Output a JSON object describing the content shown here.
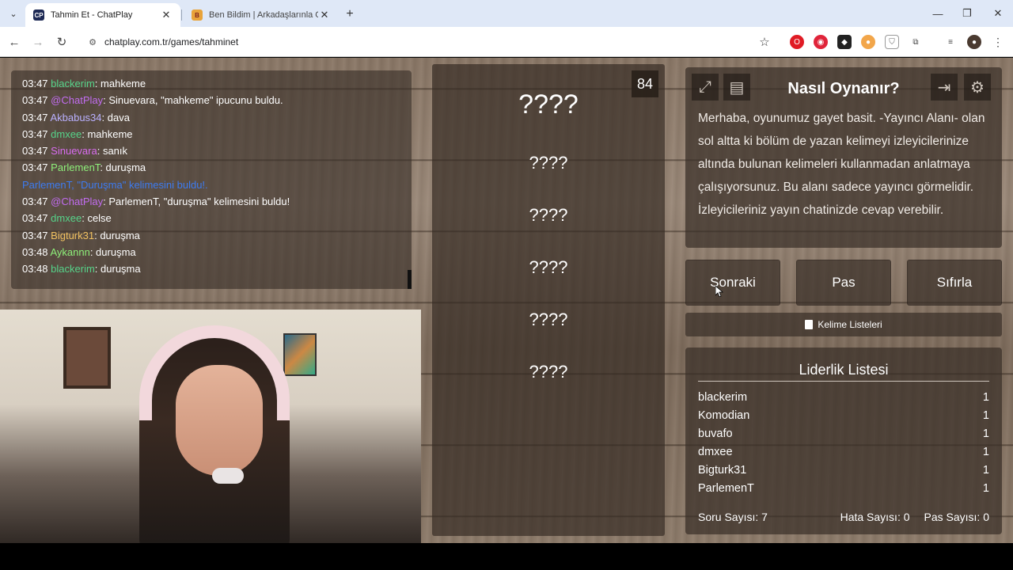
{
  "browser": {
    "tabs": [
      {
        "title": "Tahmin Et - ChatPlay",
        "active": true,
        "favicon": "chatplay-favicon"
      },
      {
        "title": "Ben Bildim | Arkadaşlarınla Onli",
        "active": false,
        "favicon": "benbildim-favicon"
      }
    ],
    "url": "chatplay.com.tr/games/tahminet"
  },
  "chat": {
    "lines": [
      {
        "time": "03:47",
        "user": "blackerim",
        "sep": ": ",
        "msg": "mahkeme",
        "color": "#56d48a"
      },
      {
        "time": "03:47",
        "user": "@ChatPlay",
        "sep": ": ",
        "msg": "Sinuevara, \"mahkeme\" ipucunu buldu.",
        "color": "#c16cf0"
      },
      {
        "time": "03:47",
        "user": "Akbabus34",
        "sep": ": ",
        "msg": "dava",
        "color": "#b9b0ff"
      },
      {
        "time": "03:47",
        "user": "dmxee",
        "sep": ": ",
        "msg": "mahkeme",
        "color": "#56d48a"
      },
      {
        "time": "03:47",
        "user": "Sinuevara",
        "sep": ": ",
        "msg": "sanık",
        "color": "#d86cf0"
      },
      {
        "time": "03:47",
        "user": "ParlemenT",
        "sep": ": ",
        "msg": "duruşma",
        "color": "#8ef07a"
      },
      {
        "time": "",
        "user": "",
        "sep": "",
        "msg": "ParlemenT, \"Duruşma\" kelimesini buldu!.",
        "color": "#3d7bf0",
        "system": true
      },
      {
        "time": "03:47",
        "user": "@ChatPlay",
        "sep": ": ",
        "msg": "ParlemenT, \"duruşma\" kelimesini buldu!",
        "color": "#c16cf0"
      },
      {
        "time": "03:47",
        "user": "dmxee",
        "sep": ": ",
        "msg": "celse",
        "color": "#56d48a"
      },
      {
        "time": "03:47",
        "user": "Bigturk31",
        "sep": ": ",
        "msg": "duruşma",
        "color": "#f0c060"
      },
      {
        "time": "03:48",
        "user": "Aykannn",
        "sep": ": ",
        "msg": "duruşma",
        "color": "#8ef07a"
      },
      {
        "time": "03:48",
        "user": "blackerim",
        "sep": ": ",
        "msg": "duruşma",
        "color": "#56d48a"
      }
    ]
  },
  "game": {
    "timer": "84",
    "main_word": "????",
    "hints": [
      "????",
      "????",
      "????",
      "????",
      "????"
    ]
  },
  "howto": {
    "title": "Nasıl Oynanır?",
    "text": "Merhaba, oyunumuz gayet basit. -Yayıncı Alanı- olan sol altta ki bölüm de yazan kelimeyi izleyicilerinize altında bulunan kelimeleri kullanmadan anlatmaya çalışıyorsunuz. Bu alanı sadece yayıncı görmelidir. İzleyicileriniz yayın chatinizde cevap verebilir."
  },
  "controls": {
    "next": "Sonraki",
    "pass": "Pas",
    "reset": "Sıfırla",
    "word_lists": "Kelime Listeleri"
  },
  "leaderboard": {
    "title": "Liderlik Listesi",
    "rows": [
      {
        "name": "blackerim",
        "score": "1"
      },
      {
        "name": "Komodian",
        "score": "1"
      },
      {
        "name": "buvafo",
        "score": "1"
      },
      {
        "name": "dmxee",
        "score": "1"
      },
      {
        "name": "Bigturk31",
        "score": "1"
      },
      {
        "name": "ParlemenT",
        "score": "1"
      }
    ],
    "question_count": "Soru Sayısı: 7",
    "error_count": "Hata Sayısı: 0",
    "pass_count": "Pas Sayısı: 0"
  }
}
